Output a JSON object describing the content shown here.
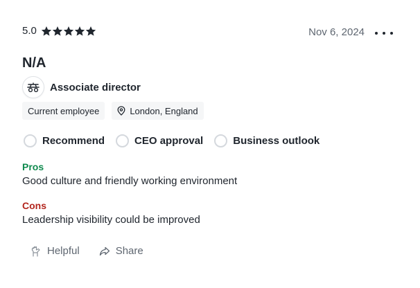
{
  "review": {
    "rating": "5.0",
    "stars_filled": 5,
    "stars_total": 5,
    "date": "Nov 6, 2024",
    "title": "N/A",
    "job_title": "Associate director",
    "tags": {
      "employment_status": "Current employee",
      "location": "London, England"
    },
    "indicators": [
      {
        "label": "Recommend",
        "state": "neutral"
      },
      {
        "label": "CEO approval",
        "state": "neutral"
      },
      {
        "label": "Business outlook",
        "state": "neutral"
      }
    ],
    "pros": {
      "label": "Pros",
      "text": "Good culture and friendly working environment"
    },
    "cons": {
      "label": "Cons",
      "text": "Leadership visibility could be improved"
    },
    "actions": {
      "helpful_label": "Helpful",
      "share_label": "Share"
    }
  },
  "icons": {
    "star": "star-icon",
    "more": "more-options-icon",
    "logo": "employer-logo-icon",
    "location": "location-pin-icon",
    "helpful": "helpful-hand-icon",
    "share": "share-arrow-icon"
  },
  "colors": {
    "text": "#20262e",
    "muted": "#5e6670",
    "pros": "#0f8a4e",
    "cons": "#b3261e",
    "indicator_border": "#d4d8dd",
    "tag_background": "#f5f6f7"
  }
}
